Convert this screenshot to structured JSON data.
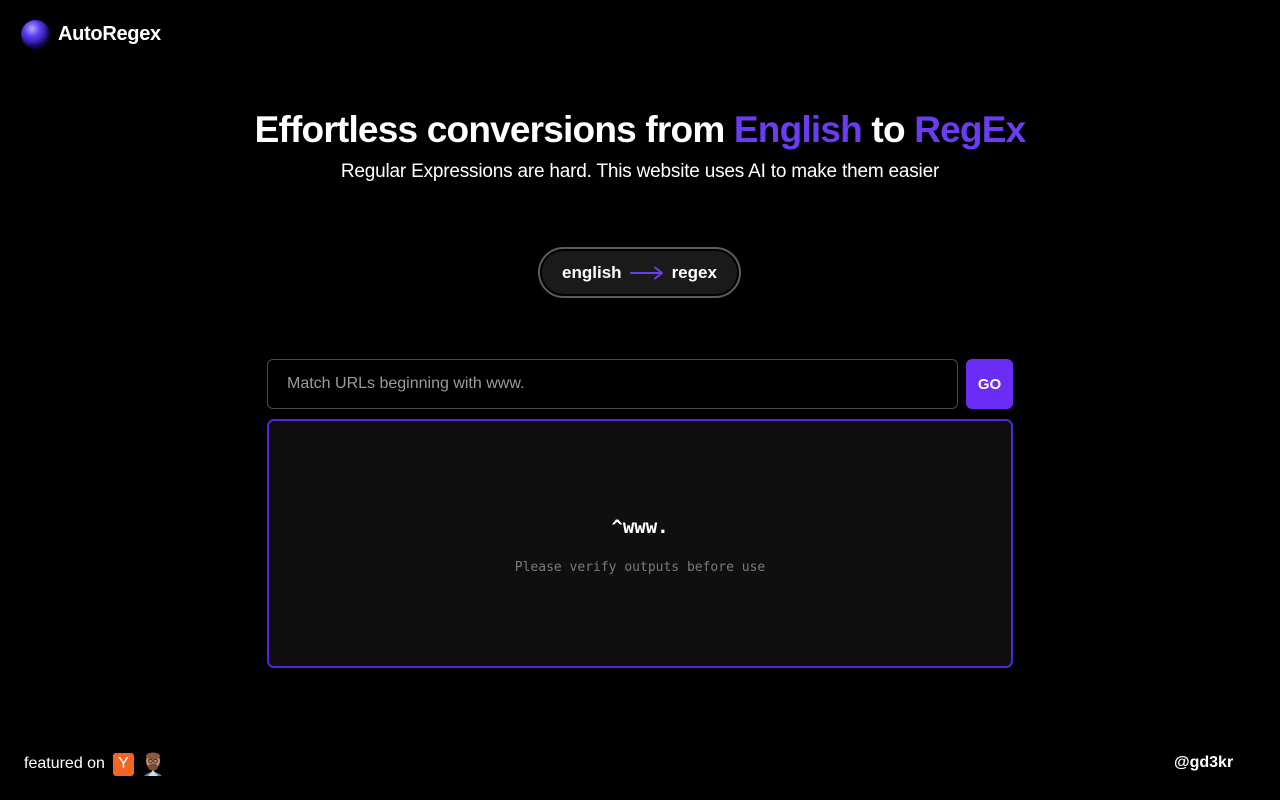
{
  "app": {
    "name": "AutoRegex",
    "logo_icon": "purple-orb-icon"
  },
  "hero": {
    "title_part1": "Effortless conversions from ",
    "title_accent1": "English",
    "title_part2": " to ",
    "title_accent2": "RegEx",
    "subtitle": "Regular Expressions are hard. This website uses AI to make them easier"
  },
  "mode_toggle": {
    "from": "english",
    "to": "regex",
    "icon": "arrow-right-icon"
  },
  "query": {
    "value": "",
    "placeholder": "Match URLs beginning with www.",
    "go_label": "GO"
  },
  "output": {
    "regex": "^www.",
    "note": "Please verify outputs before use"
  },
  "footer": {
    "featured_label": "featured on",
    "featured_icons": [
      "y-combinator-icon",
      "avatar-icon"
    ],
    "handle": "@gd3kr"
  },
  "colors": {
    "background": "#000000",
    "accent": "#6b3cf0",
    "button": "#6b2cf5",
    "panel_border": "#5424e0",
    "yc_orange": "#f26522"
  }
}
